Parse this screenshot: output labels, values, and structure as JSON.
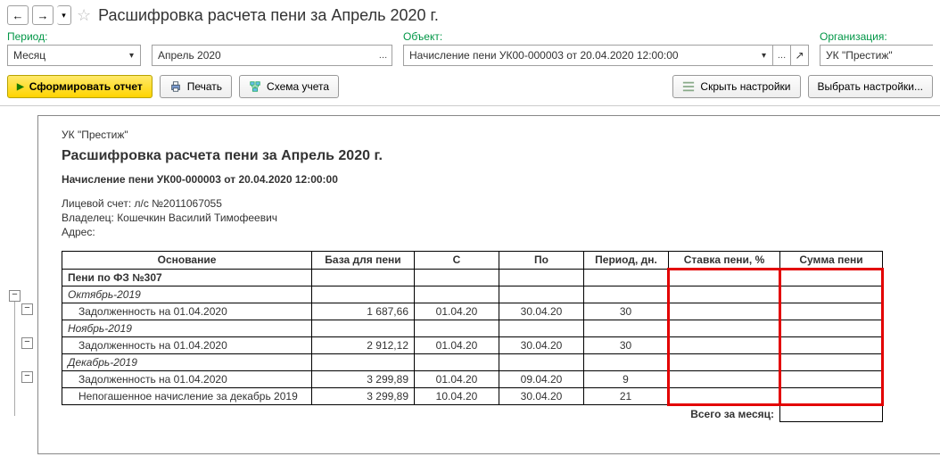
{
  "title": "Расшифровка расчета пени  за Апрель 2020 г.",
  "filters": {
    "period_label": "Период:",
    "period_mode": "Месяц",
    "period_value": "Апрель 2020",
    "object_label": "Объект:",
    "object_value": "Начисление пени УК00-000003 от 20.04.2020 12:00:00",
    "org_label": "Организация:",
    "org_value": "УК \"Престиж\""
  },
  "toolbar": {
    "form": "Сформировать отчет",
    "print": "Печать",
    "schema": "Схема учета",
    "hide": "Скрыть настройки",
    "choose": "Выбрать настройки..."
  },
  "report": {
    "org": "УК \"Престиж\"",
    "title": "Расшифровка расчета пени за Апрель 2020 г.",
    "charge": "Начисление пени УК00-000003 от 20.04.2020 12:00:00",
    "account_label": "Лицевой счет:",
    "account_value": "л/с №2011067055",
    "owner_label": "Владелец:",
    "owner_value": "Кошечкин Василий Тимофеевич",
    "address_label": "Адрес:"
  },
  "columns": {
    "basis": "Основание",
    "base": "База для пени",
    "from": "С",
    "to": "По",
    "period": "Период, дн.",
    "rate": "Ставка пени, %",
    "sum": "Сумма пени"
  },
  "section": "Пени по ФЗ №307",
  "groups": [
    {
      "month": "Октябрь-2019",
      "rows": [
        {
          "basis": "Задолженность на 01.04.2020",
          "base": "1 687,66",
          "from": "01.04.20",
          "to": "30.04.20",
          "period": "30",
          "rate": "",
          "sum": ""
        }
      ]
    },
    {
      "month": "Ноябрь-2019",
      "rows": [
        {
          "basis": "Задолженность на 01.04.2020",
          "base": "2 912,12",
          "from": "01.04.20",
          "to": "30.04.20",
          "period": "30",
          "rate": "",
          "sum": ""
        }
      ]
    },
    {
      "month": "Декабрь-2019",
      "rows": [
        {
          "basis": "Задолженность на 01.04.2020",
          "base": "3 299,89",
          "from": "01.04.20",
          "to": "09.04.20",
          "period": "9",
          "rate": "",
          "sum": ""
        },
        {
          "basis": "Непогашенное начисление за декабрь 2019",
          "base": "3 299,89",
          "from": "10.04.20",
          "to": "30.04.20",
          "period": "21",
          "rate": "",
          "sum": ""
        }
      ]
    }
  ],
  "total_label": "Всего за месяц:"
}
